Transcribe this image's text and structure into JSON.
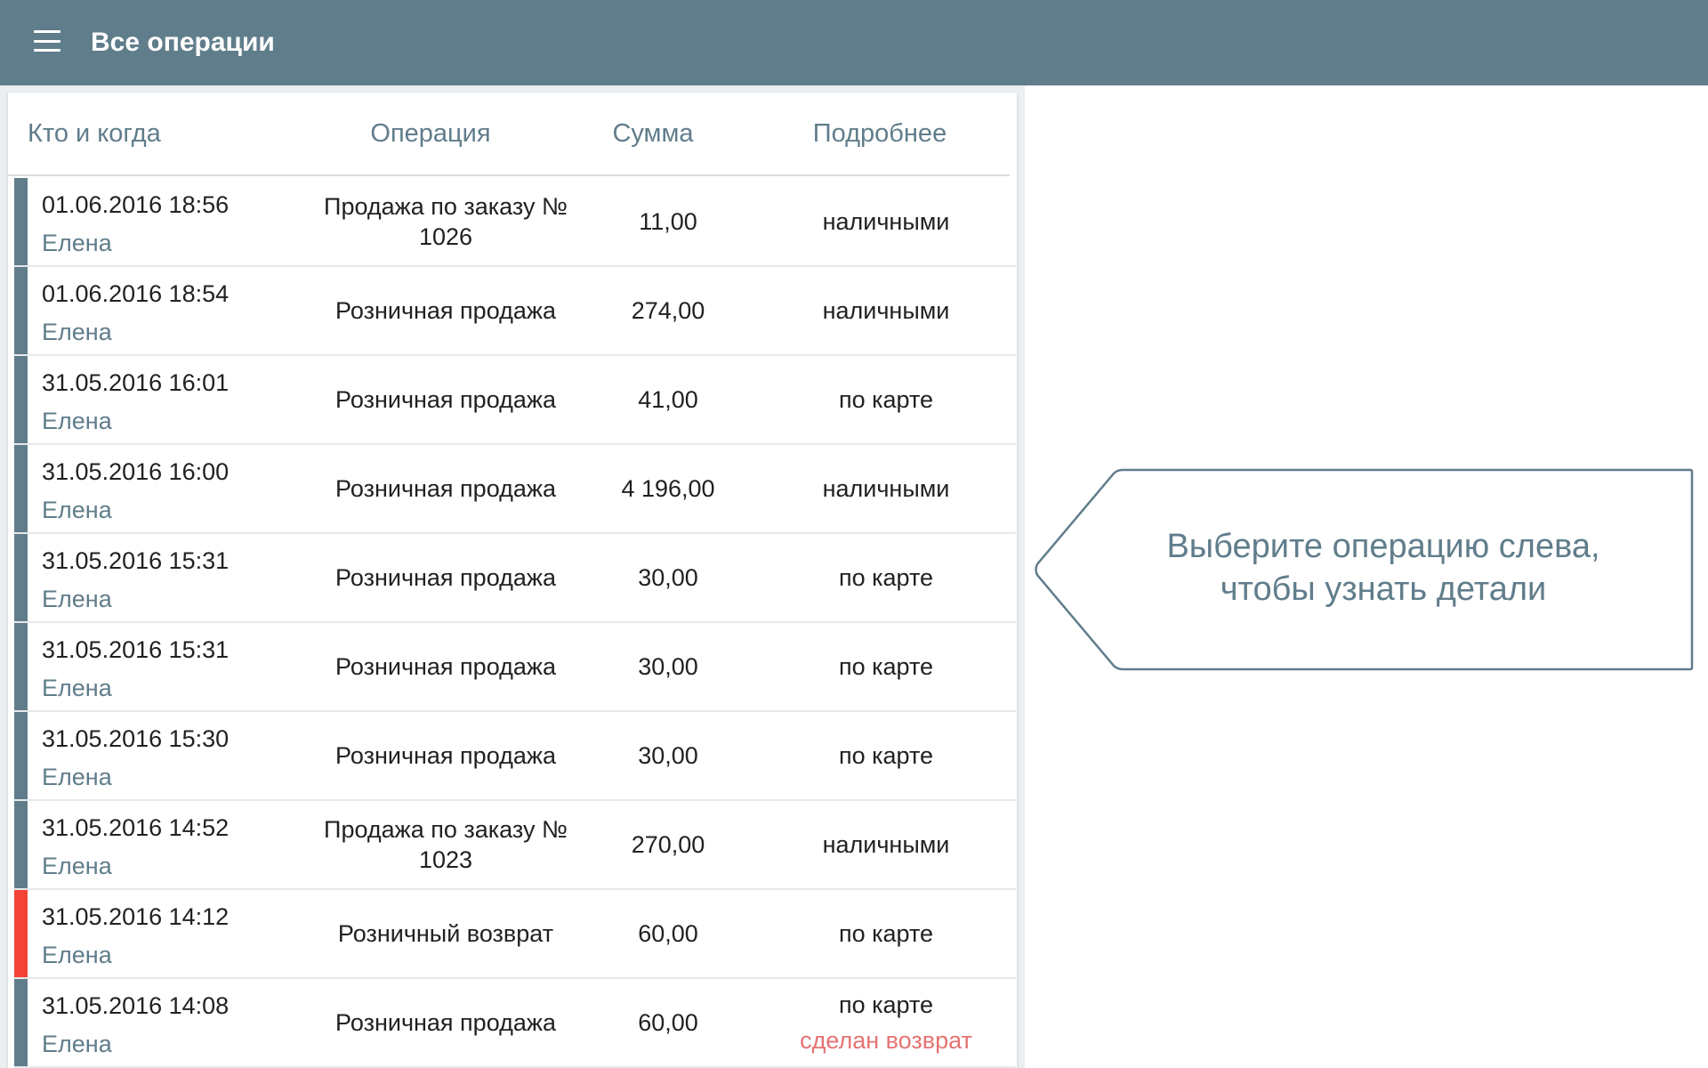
{
  "appbar": {
    "title": "Все операции",
    "menu_icon": "hamburger-menu-icon"
  },
  "table": {
    "headers": {
      "who": "Кто и когда",
      "operation": "Операция",
      "sum": "Сумма",
      "details": "Подробнее"
    },
    "rows": [
      {
        "date": "01.06.2016 18:56",
        "user": "Елена",
        "operation": "Продажа по заказу № 1026",
        "sum": "11,00",
        "details": "наличными",
        "note": ""
      },
      {
        "date": "01.06.2016 18:54",
        "user": "Елена",
        "operation": "Розничная продажа",
        "sum": "274,00",
        "details": "наличными",
        "note": ""
      },
      {
        "date": "31.05.2016 16:01",
        "user": "Елена",
        "operation": "Розничная продажа",
        "sum": "41,00",
        "details": "по карте",
        "note": ""
      },
      {
        "date": "31.05.2016 16:00",
        "user": "Елена",
        "operation": "Розничная продажа",
        "sum": "4 196,00",
        "details": "наличными",
        "note": ""
      },
      {
        "date": "31.05.2016 15:31",
        "user": "Елена",
        "operation": "Розничная продажа",
        "sum": "30,00",
        "details": "по карте",
        "note": ""
      },
      {
        "date": "31.05.2016 15:31",
        "user": "Елена",
        "operation": "Розничная продажа",
        "sum": "30,00",
        "details": "по карте",
        "note": ""
      },
      {
        "date": "31.05.2016 15:30",
        "user": "Елена",
        "operation": "Розничная продажа",
        "sum": "30,00",
        "details": "по карте",
        "note": ""
      },
      {
        "date": "31.05.2016 14:52",
        "user": "Елена",
        "operation": "Продажа по заказу № 1023",
        "sum": "270,00",
        "details": "наличными",
        "note": ""
      },
      {
        "date": "31.05.2016 14:12",
        "user": "Елена",
        "operation": "Розничный возврат",
        "sum": "60,00",
        "details": "по карте",
        "note": ""
      },
      {
        "date": "31.05.2016 14:08",
        "user": "Елена",
        "operation": "Розничная продажа",
        "sum": "60,00",
        "details": "по карте",
        "note": "сделан возврат"
      }
    ]
  },
  "hint": {
    "line1": "Выберите операцию слева,",
    "line2": "чтобы узнать детали"
  },
  "colors": {
    "primary": "#607d8b",
    "refund_marker": "#f44336",
    "note_text": "#e57373"
  }
}
